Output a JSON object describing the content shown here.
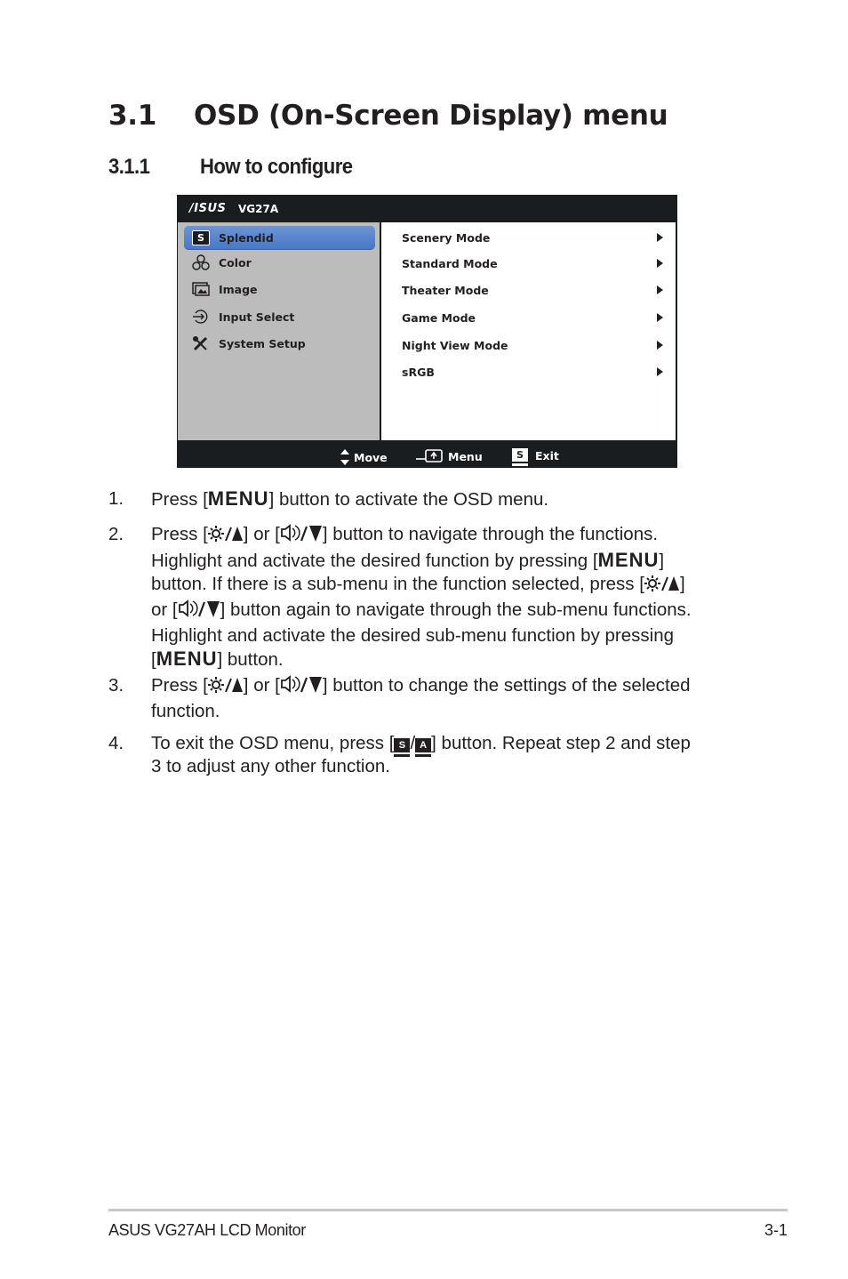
{
  "heading": {
    "number": "3.1",
    "title": "OSD (On-Screen Display) menu"
  },
  "subheading": {
    "number": "3.1.1",
    "title": "How to configure"
  },
  "osd": {
    "brand": "/ISUS",
    "model": "VG27A",
    "colors": {
      "frame": "#1a1d20",
      "left_panel": "#bcbcbc",
      "selected": "#5a86cc",
      "right_panel": "#ffffff"
    },
    "left_menu": [
      {
        "label": "Splendid",
        "icon": "splendid-s-icon",
        "selected": true
      },
      {
        "label": "Color",
        "icon": "rgb-circles-icon",
        "selected": false
      },
      {
        "label": "Image",
        "icon": "image-icon",
        "selected": false
      },
      {
        "label": "Input Select",
        "icon": "input-arrow-icon",
        "selected": false
      },
      {
        "label": "System Setup",
        "icon": "tools-icon",
        "selected": false
      }
    ],
    "right_menu": [
      {
        "label": "Scenery Mode",
        "icon": "arrow-right-icon"
      },
      {
        "label": "Standard Mode",
        "icon": "arrow-right-icon"
      },
      {
        "label": "Theater Mode",
        "icon": "arrow-right-icon"
      },
      {
        "label": "Game Mode",
        "icon": "arrow-right-icon"
      },
      {
        "label": "Night View Mode",
        "icon": "arrow-right-icon"
      },
      {
        "label": "sRGB",
        "icon": "arrow-right-icon"
      }
    ],
    "footer": {
      "move": "Move",
      "menu": "Menu",
      "exit": "Exit",
      "exit_badge": "S"
    }
  },
  "steps": [
    {
      "number": "1.",
      "parts": [
        "Press [",
        "MENU",
        "] button to activate the OSD menu."
      ]
    },
    {
      "number": "2.",
      "t1": "Press [",
      "t2": "] or [",
      "t3": "] button to navigate through the functions.",
      "t4": "Highlight and activate the desired function by pressing [",
      "menu": "MENU",
      "t5": "]",
      "t6": "button. If there is a sub-menu in the function selected, press [",
      "t7": "]",
      "t8": "or [",
      "t9": "] button again to navigate through the sub-menu functions.",
      "t10": "Highlight and activate the desired sub-menu function by pressing",
      "t11": "[",
      "t12": "] button."
    },
    {
      "number": "3.",
      "t1": "Press [",
      "t2": "] or [",
      "t3": "] button to change the settings of the selected",
      "t4": "function."
    },
    {
      "number": "4.",
      "t1": "To exit the OSD menu, press [",
      "s": "S",
      "slash": "/",
      "a": "A",
      "t2": "] button. Repeat step 2 and step",
      "t3": "3 to adjust any other function."
    }
  ],
  "footer": {
    "left": "ASUS VG27AH LCD Monitor",
    "right": "3-1"
  }
}
